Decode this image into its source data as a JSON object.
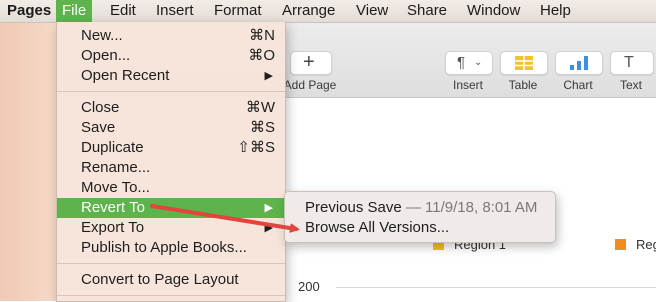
{
  "menubar": {
    "items": [
      "Pages",
      "File",
      "Edit",
      "Insert",
      "Format",
      "Arrange",
      "View",
      "Share",
      "Window",
      "Help"
    ]
  },
  "toolbar": {
    "add_page_label": "Add Page",
    "insert_label": "Insert",
    "table_label": "Table",
    "chart_label": "Chart",
    "text_label": "Text"
  },
  "file_menu": {
    "items": [
      {
        "label": "New...",
        "shortcut": "⌘N"
      },
      {
        "label": "Open...",
        "shortcut": "⌘O"
      },
      {
        "label": "Open Recent",
        "shortcut": "▶"
      },
      {
        "label": "Close",
        "shortcut": "⌘W"
      },
      {
        "label": "Save",
        "shortcut": "⌘S"
      },
      {
        "label": "Duplicate",
        "shortcut": "⇧⌘S"
      },
      {
        "label": "Rename...",
        "shortcut": ""
      },
      {
        "label": "Move To...",
        "shortcut": ""
      },
      {
        "label": "Revert To",
        "shortcut": "▶"
      },
      {
        "label": "Export To",
        "shortcut": "▶"
      },
      {
        "label": "Publish to Apple Books...",
        "shortcut": ""
      },
      {
        "label": "Convert to Page Layout",
        "shortcut": ""
      }
    ]
  },
  "revert_submenu": {
    "previous_save_label": "Previous Save",
    "previous_save_date": "— 11/9/18, 8:01 AM",
    "browse_label": "Browse All Versions..."
  },
  "document": {
    "legend_region1": "Region 1",
    "legend_region2": "Reg",
    "axis_tick_200": "200"
  },
  "colors": {
    "highlight": "#5fb34c",
    "arrow": "#e0453e",
    "legend_region1": "#f0c419",
    "legend_region2": "#f28c1c",
    "table_icon": "#f2c233",
    "chart_icon": "#3d8fe0"
  }
}
